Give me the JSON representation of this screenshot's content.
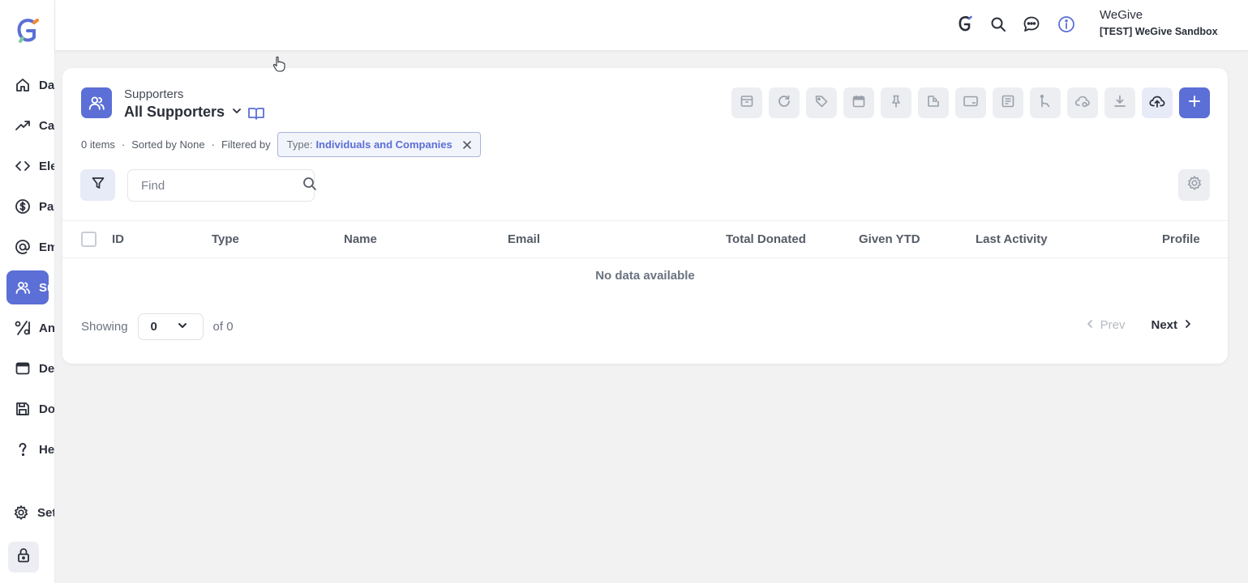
{
  "sidebar": {
    "items": [
      {
        "label": "Dashboard",
        "icon": "home-icon"
      },
      {
        "label": "Campaigns",
        "icon": "trending-up-icon"
      },
      {
        "label": "Elements",
        "icon": "code-icon"
      },
      {
        "label": "Payments",
        "icon": "dollar-icon"
      },
      {
        "label": "Emails",
        "icon": "at-icon"
      },
      {
        "label": "Supporters",
        "icon": "users-icon",
        "active": true
      },
      {
        "label": "Analytics",
        "icon": "percent-icon"
      },
      {
        "label": "Designer",
        "icon": "browser-icon"
      },
      {
        "label": "Documents",
        "icon": "save-icon"
      },
      {
        "label": "Help",
        "icon": "question-icon"
      }
    ],
    "settings_label": "Settings"
  },
  "topbar": {
    "org_name": "WeGive",
    "org_sub": "[TEST] WeGive Sandbox"
  },
  "header": {
    "breadcrumb": "Supporters",
    "view_title": "All Supporters"
  },
  "meta": {
    "items_count": "0 items",
    "sorted_by": "Sorted by None",
    "filtered_by": "Filtered by",
    "filter_key": "Type:",
    "filter_value": "Individuals and Companies"
  },
  "search": {
    "placeholder": "Find"
  },
  "table": {
    "columns": [
      "ID",
      "Type",
      "Name",
      "Email",
      "Total Donated",
      "Given YTD",
      "Last Activity",
      "Profile"
    ],
    "empty_text": "No data available"
  },
  "pagination": {
    "showing_label": "Showing",
    "page_size": "0",
    "of_label": "of 0",
    "prev_label": "Prev",
    "next_label": "Next"
  },
  "colors": {
    "accent": "#5b6fd6",
    "background": "#f2f2f3"
  }
}
